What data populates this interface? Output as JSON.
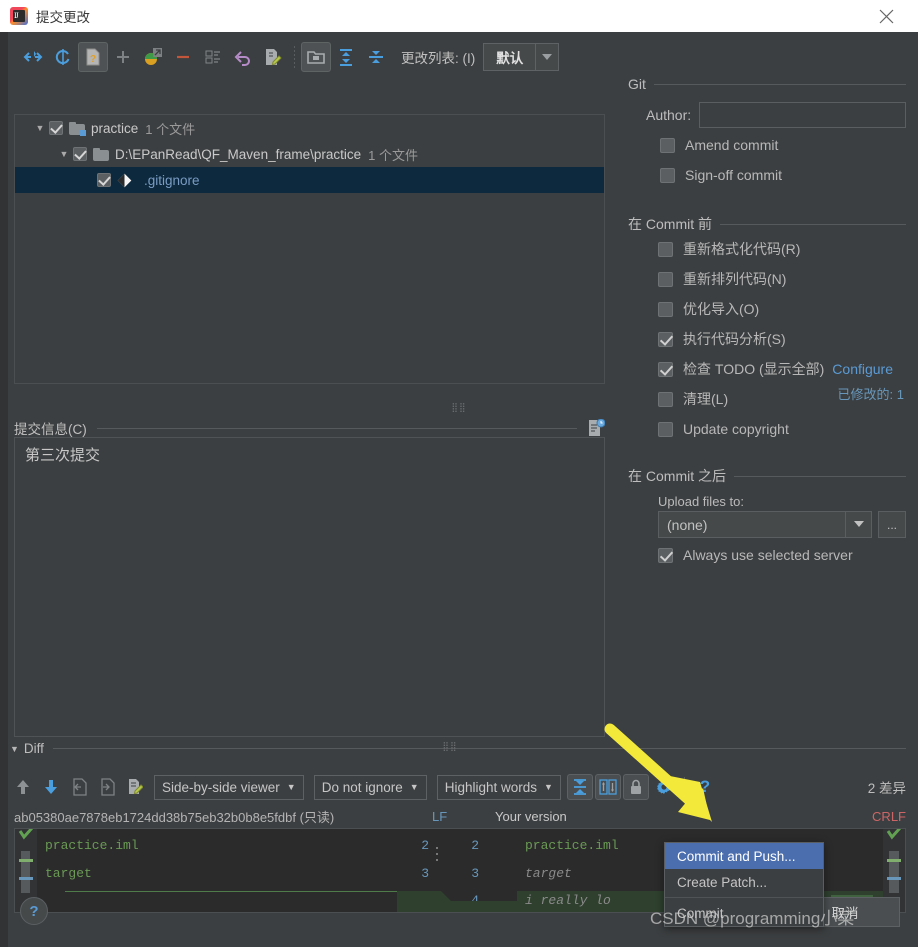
{
  "window": {
    "title": "提交更改",
    "close_label": "✕",
    "app_icon": "intellij-idea-icon"
  },
  "toolbar": {
    "icons": [
      {
        "name": "collapse-arrows-icon",
        "glyph": "⇤⇥"
      },
      {
        "name": "refresh-icon",
        "glyph": "↻"
      },
      {
        "name": "unversioned-files-icon",
        "glyph": "?"
      },
      {
        "name": "add-icon",
        "glyph": "+"
      },
      {
        "name": "move-to-changelist-icon",
        "glyph": "↗"
      },
      {
        "name": "remove-icon",
        "glyph": "—"
      },
      {
        "name": "edit-changelist-icon",
        "glyph": "≡"
      },
      {
        "name": "rollback-icon",
        "glyph": "↺"
      },
      {
        "name": "show-diff-icon",
        "glyph": "✎"
      },
      {
        "name": "group-by-directory-icon",
        "glyph": "▣"
      },
      {
        "name": "expand-all-icon",
        "glyph": "⇕"
      },
      {
        "name": "collapse-all-icon",
        "glyph": "⇳"
      }
    ],
    "changelist_label": "更改列表: (I)",
    "changelist_value": "默认"
  },
  "tree": {
    "rows": [
      {
        "indent": 0,
        "twisty": "▼",
        "checked": true,
        "icon": "folder-module-icon",
        "name": "practice",
        "count": "1 个文件",
        "selected": false,
        "name_color": "normal"
      },
      {
        "indent": 1,
        "twisty": "▼",
        "checked": true,
        "icon": "folder-icon",
        "name": "D:\\EPanRead\\QF_Maven_frame\\practice",
        "count": "1 个文件",
        "selected": false,
        "name_color": "normal"
      },
      {
        "indent": 2,
        "twisty": "",
        "checked": true,
        "icon": "git-file-icon",
        "name": ".gitignore",
        "count": "",
        "selected": true,
        "name_color": "blue"
      }
    ],
    "modified_label": "已修改的: 1"
  },
  "commit_message": {
    "section_label": "提交信息(C)",
    "history_icon": "commit-message-history-icon",
    "value": "第三次提交"
  },
  "right_panel": {
    "git": {
      "title": "Git",
      "author_label": "Author:",
      "author_value": "",
      "options": [
        {
          "label": "Amend commit",
          "checked": false,
          "name": "amend-commit"
        },
        {
          "label": "Sign-off commit",
          "checked": false,
          "name": "sign-off-commit"
        }
      ]
    },
    "before_commit": {
      "title": "在 Commit 前",
      "options": [
        {
          "label": "重新格式化代码(R)",
          "checked": false,
          "name": "reformat-code",
          "link": ""
        },
        {
          "label": "重新排列代码(N)",
          "checked": false,
          "name": "rearrange-code",
          "link": ""
        },
        {
          "label": "优化导入(O)",
          "checked": false,
          "name": "optimize-imports",
          "link": ""
        },
        {
          "label": "执行代码分析(S)",
          "checked": true,
          "name": "run-code-analysis",
          "link": ""
        },
        {
          "label": "检查 TODO (显示全部)",
          "checked": true,
          "name": "check-todo",
          "link": "Configure"
        },
        {
          "label": "清理(L)",
          "checked": false,
          "name": "cleanup",
          "link": ""
        },
        {
          "label": "Update copyright",
          "checked": false,
          "name": "update-copyright",
          "link": ""
        }
      ]
    },
    "after_commit": {
      "title": "在 Commit 之后",
      "upload_label": "Upload files to:",
      "upload_value": "(none)",
      "ellipsis_label": "...",
      "always_use_label": "Always use selected server",
      "always_use_checked": true
    }
  },
  "diff": {
    "section_label": "Diff",
    "toolbar_icons": [
      {
        "name": "previous-difference-icon",
        "glyph": "↑"
      },
      {
        "name": "next-difference-icon",
        "glyph": "↓"
      },
      {
        "name": "accept-left-icon",
        "glyph": "⇥"
      },
      {
        "name": "accept-right-icon",
        "glyph": "⇤"
      },
      {
        "name": "edit-source-icon",
        "glyph": "✎"
      }
    ],
    "viewer_mode": "Side-by-side viewer",
    "ignore_mode": "Do not ignore",
    "highlight_mode": "Highlight words",
    "right_icons": [
      {
        "name": "collapse-unchanged-icon",
        "glyph": "⇳"
      },
      {
        "name": "synchronize-scrolling-icon",
        "glyph": "⇅⇅"
      },
      {
        "name": "readonly-lock-icon",
        "glyph": "🔒"
      },
      {
        "name": "settings-gear-icon",
        "glyph": "⚙"
      },
      {
        "name": "help-icon",
        "glyph": "?"
      }
    ],
    "difference_count": "2 差异",
    "left_revision": "ab05380ae7878eb1724dd38b75eb32b0b8e5fdbf (只读)",
    "left_line_ending": "LF",
    "right_title": "Your version",
    "right_line_ending": "CRLF",
    "left_lines": [
      {
        "text": "practice.iml",
        "style": "green"
      },
      {
        "text": "target",
        "style": "green"
      }
    ],
    "line_numbers_left": [
      "2",
      "3",
      ""
    ],
    "line_numbers_right": [
      "2",
      "3",
      "4"
    ],
    "right_lines": [
      {
        "text": "practice.iml",
        "style": "green"
      },
      {
        "text": "target",
        "style": "gray-italic"
      },
      {
        "text": "i really lo",
        "style": "gray-italic"
      }
    ]
  },
  "context_menu": {
    "items": [
      {
        "label": "Commit and Push...",
        "highlighted": true,
        "name": "commit-and-push"
      },
      {
        "label": "Create Patch...",
        "highlighted": false,
        "name": "create-patch"
      },
      {
        "label": "Commit",
        "highlighted": false,
        "name": "commit"
      }
    ]
  },
  "footer": {
    "help_label": "?",
    "commit_label": "Commit",
    "commit_arrow": "▾",
    "cancel_label": "取消"
  },
  "watermark": "CSDN @programming小菜",
  "colors": {
    "background": "#3c3f41",
    "selection": "#0d293e",
    "accent_blue": "#4b6eaf",
    "link_blue": "#5a9bd5",
    "diff_green": "#6a9a55",
    "crlf_red": "#cc6666",
    "arrow_yellow": "#f2e93b"
  }
}
